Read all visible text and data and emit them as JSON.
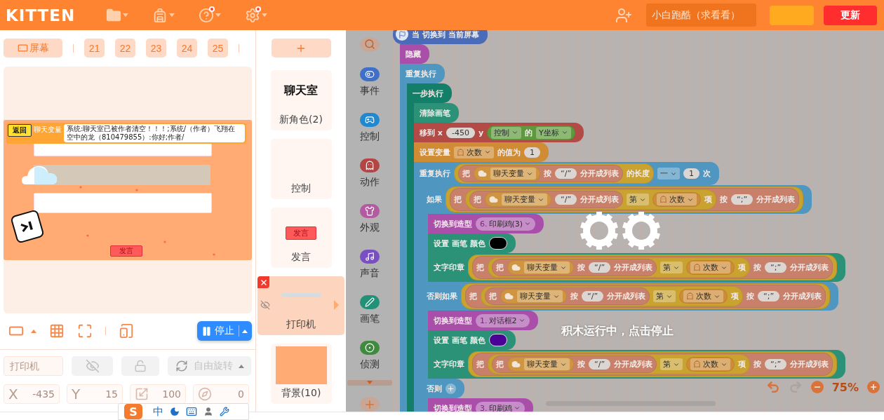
{
  "topbar": {
    "logo": "KITTEN",
    "menus": [
      {
        "kind": "folder",
        "badge": false
      },
      {
        "kind": "backpack",
        "badge": false
      },
      {
        "kind": "help",
        "badge": true
      },
      {
        "kind": "settings",
        "badge": true
      }
    ],
    "project_name": "小白跑酷（求看看）",
    "update_button": "更新"
  },
  "screen_bar": {
    "screen_button": "屏幕",
    "tabs": [
      "21",
      "22",
      "23",
      "24",
      "25"
    ]
  },
  "stage": {
    "tag": "返回",
    "monitor": {
      "name": "聊天变量",
      "value": "系统:聊天室已被作者清空！！！;系统/（作者）飞翔在空中的龙（810479855）:你好;作者/"
    },
    "send_button": "发言"
  },
  "stage_controls": {
    "stop_button": "停止"
  },
  "sprite_props": {
    "name_placeholder": "打印机",
    "rotation": "自由旋转",
    "fields": [
      {
        "kind": "label",
        "label": "X",
        "value": "-435"
      },
      {
        "kind": "label",
        "label": "Y",
        "value": "15"
      },
      {
        "kind": "size",
        "value": "100"
      },
      {
        "kind": "direction",
        "value": "0"
      }
    ]
  },
  "sprites": [
    {
      "name": "新角色(2)",
      "preview": {
        "kind": "text",
        "text": "聊天室"
      },
      "selected": false
    },
    {
      "name": "控制",
      "preview": {
        "kind": "empty"
      },
      "selected": false
    },
    {
      "name": "发言",
      "preview": {
        "kind": "button",
        "text": "发言"
      },
      "selected": false
    },
    {
      "name": "打印机",
      "preview": {
        "kind": "bar"
      },
      "selected": true
    },
    {
      "name": "背景(10)",
      "preview": {
        "kind": "fill"
      },
      "selected": false
    }
  ],
  "categories": [
    {
      "label": "事件",
      "kind": "toggle",
      "color": "#3f6fc6"
    },
    {
      "label": "控制",
      "kind": "gamepad",
      "color": "#1e88d0"
    },
    {
      "label": "动作",
      "kind": "ghost",
      "color": "#b54545"
    },
    {
      "label": "外观",
      "kind": "shirt",
      "color": "#b45aa0"
    },
    {
      "label": "声音",
      "kind": "music",
      "color": "#7a4fc2"
    },
    {
      "label": "画笔",
      "kind": "pen",
      "color": "#239178"
    },
    {
      "label": "侦测",
      "kind": "target",
      "color": "#3f8a3f"
    }
  ],
  "script": [
    {
      "kind": "hat",
      "color": "#4a6cb8",
      "parts": [
        {
          "kind": "text",
          "v": "当 切换到 当前屏幕"
        }
      ]
    },
    {
      "kind": "stack",
      "color": "#a94fa9",
      "parts": [
        {
          "kind": "text",
          "v": "隐藏"
        }
      ]
    },
    {
      "kind": "c",
      "color": "#4f97c0",
      "parts": [
        {
          "kind": "text",
          "v": "重复执行"
        }
      ],
      "children": [
        {
          "kind": "c",
          "color": "#137f68",
          "parts": [
            {
              "kind": "text",
              "v": "一步执行"
            }
          ],
          "children": [
            {
              "kind": "stack",
              "color": "#2b9177",
              "parts": [
                {
                  "kind": "text",
                  "v": "清除画笔"
                }
              ]
            },
            {
              "kind": "stack",
              "color": "#b44a46",
              "parts": [
                {
                  "kind": "text",
                  "v": "移到 x"
                },
                {
                  "kind": "num",
                  "v": "-450"
                },
                {
                  "kind": "text",
                  "v": "y"
                },
                {
                  "kind": "reporter",
                  "color": "#5c9a3c",
                  "parts": [
                    {
                      "kind": "dropdown",
                      "v": "控制"
                    },
                    {
                      "kind": "text",
                      "v": "的"
                    },
                    {
                      "kind": "dropdown",
                      "v": "Y坐标"
                    }
                  ]
                }
              ]
            },
            {
              "kind": "stack",
              "color": "#cf8c35",
              "parts": [
                {
                  "kind": "text",
                  "v": "设置变量"
                },
                {
                  "kind": "vardrop",
                  "v": "次数"
                },
                {
                  "kind": "text",
                  "v": "的值为"
                },
                {
                  "kind": "num",
                  "v": "1"
                }
              ]
            },
            {
              "kind": "c",
              "color": "#4f97c0",
              "parts": [
                {
                  "kind": "text",
                  "v": "重复执行"
                },
                {
                  "kind": "reporter",
                  "color": "#c9a230",
                  "parts": [
                    {
                      "kind": "reporter",
                      "color": "#c8806a",
                      "parts": [
                        {
                          "kind": "text",
                          "v": "把"
                        },
                        {
                          "kind": "cloud",
                          "v": "聊天变量"
                        },
                        {
                          "kind": "text",
                          "v": "按"
                        },
                        {
                          "kind": "str",
                          "v": "“/”"
                        },
                        {
                          "kind": "text",
                          "v": "分开成列表"
                        }
                      ]
                    },
                    {
                      "kind": "text",
                      "v": "的长度"
                    }
                  ]
                },
                {
                  "kind": "dropdown",
                  "v": "一"
                },
                {
                  "kind": "num",
                  "v": "1"
                },
                {
                  "kind": "text",
                  "v": "次"
                }
              ],
              "children": [
                {
                  "kind": "if",
                  "color": "#4f97c0",
                  "branches": [
                    {
                      "parts": [
                        {
                          "kind": "text",
                          "v": "如果"
                        },
                        {
                          "kind": "reporter",
                          "color": "#c9a230",
                          "parts": [
                            {
                              "kind": "reporter",
                              "color": "#c8806a",
                              "parts": [
                                {
                                  "kind": "text",
                                  "v": "把"
                                },
                                {
                                  "kind": "reporter",
                                  "color": "#c9a230",
                                  "parts": [
                                    {
                                      "kind": "reporter",
                                      "color": "#c8806a",
                                      "parts": [
                                        {
                                          "kind": "text",
                                          "v": "把"
                                        },
                                        {
                                          "kind": "cloud",
                                          "v": "聊天变量"
                                        },
                                        {
                                          "kind": "str",
                                          "v": "“/”"
                                        },
                                        {
                                          "kind": "text",
                                          "v": "分开成列表"
                                        }
                                      ]
                                    },
                                    {
                                      "kind": "dropdown",
                                      "v": "第"
                                    },
                                    {
                                      "kind": "var",
                                      "v": "次数"
                                    },
                                    {
                                      "kind": "text",
                                      "v": "项"
                                    }
                                  ]
                                },
                                {
                                  "kind": "text",
                                  "v": "按"
                                },
                                {
                                  "kind": "str",
                                  "v": "“;”"
                                },
                                {
                                  "kind": "text",
                                  "v": "分开成列表"
                                }
                              ]
                            }
                          ]
                        }
                      ],
                      "children": [
                        {
                          "kind": "stack",
                          "color": "#a94fa9",
                          "parts": [
                            {
                              "kind": "text",
                              "v": "切换到造型"
                            },
                            {
                              "kind": "costume",
                              "index": "6.",
                              "v": "印刷鸡(3)"
                            }
                          ]
                        },
                        {
                          "kind": "stack",
                          "color": "#2b9177",
                          "parts": [
                            {
                              "kind": "text",
                              "v": "设置 画笔 颜色"
                            },
                            {
                              "kind": "color",
                              "color": "#000000"
                            }
                          ]
                        },
                        {
                          "kind": "stack",
                          "color": "#2b9177",
                          "parts": [
                            {
                              "kind": "text",
                              "v": "文字印章"
                            },
                            {
                              "kind": "reporter",
                              "color": "#c9a230",
                              "parts": [
                                {
                                  "kind": "reporter",
                                  "color": "#c8806a",
                                  "parts": [
                                    {
                                      "kind": "text",
                                      "v": "把"
                                    },
                                    {
                                      "kind": "reporter",
                                      "color": "#c9a230",
                                      "parts": [
                                        {
                                          "kind": "reporter",
                                          "color": "#c8806a",
                                          "parts": [
                                            {
                                              "kind": "text",
                                              "v": "把"
                                            },
                                            {
                                              "kind": "cloud",
                                              "v": "聊天变量"
                                            },
                                            {
                                              "kind": "text",
                                              "v": "按"
                                            },
                                            {
                                              "kind": "str",
                                              "v": "“/”"
                                            },
                                            {
                                              "kind": "text",
                                              "v": "分开成列表"
                                            }
                                          ]
                                        },
                                        {
                                          "kind": "dropdown",
                                          "v": "第"
                                        },
                                        {
                                          "kind": "var",
                                          "v": "次数"
                                        },
                                        {
                                          "kind": "text",
                                          "v": "项"
                                        }
                                      ]
                                    },
                                    {
                                      "kind": "text",
                                      "v": "按"
                                    },
                                    {
                                      "kind": "str",
                                      "v": "“;”"
                                    },
                                    {
                                      "kind": "text",
                                      "v": "分开成列表"
                                    }
                                  ]
                                }
                              ]
                            }
                          ]
                        }
                      ]
                    },
                    {
                      "parts": [
                        {
                          "kind": "text",
                          "v": "否则如果"
                        },
                        {
                          "kind": "reporter",
                          "color": "#c9a230",
                          "parts": [
                            {
                              "kind": "reporter",
                              "color": "#c8806a",
                              "parts": [
                                {
                                  "kind": "text",
                                  "v": "把"
                                },
                                {
                                  "kind": "reporter",
                                  "color": "#c9a230",
                                  "parts": [
                                    {
                                      "kind": "reporter",
                                      "color": "#c8806a",
                                      "parts": [
                                        {
                                          "kind": "text",
                                          "v": "把"
                                        },
                                        {
                                          "kind": "cloud",
                                          "v": "聊天变量"
                                        },
                                        {
                                          "kind": "text",
                                          "v": "按"
                                        },
                                        {
                                          "kind": "str",
                                          "v": "“/”"
                                        },
                                        {
                                          "kind": "text",
                                          "v": "分开成列表"
                                        }
                                      ]
                                    },
                                    {
                                      "kind": "dropdown",
                                      "v": "第"
                                    },
                                    {
                                      "kind": "var",
                                      "v": "次数"
                                    },
                                    {
                                      "kind": "text",
                                      "v": "项"
                                    }
                                  ]
                                },
                                {
                                  "kind": "text",
                                  "v": "按"
                                },
                                {
                                  "kind": "str",
                                  "v": "“;”"
                                },
                                {
                                  "kind": "text",
                                  "v": "分开成列表"
                                }
                              ]
                            }
                          ]
                        }
                      ],
                      "children": [
                        {
                          "kind": "stack",
                          "color": "#a94fa9",
                          "parts": [
                            {
                              "kind": "text",
                              "v": "切换到造型"
                            },
                            {
                              "kind": "costume",
                              "index": "1.",
                              "v": "对话框2"
                            }
                          ]
                        },
                        {
                          "kind": "stack",
                          "color": "#2b9177",
                          "parts": [
                            {
                              "kind": "text",
                              "v": "设置 画笔 颜色"
                            },
                            {
                              "kind": "color",
                              "color": "#4b0096"
                            }
                          ]
                        },
                        {
                          "kind": "stack",
                          "color": "#2b9177",
                          "parts": [
                            {
                              "kind": "text",
                              "v": "文字印章"
                            },
                            {
                              "kind": "reporter",
                              "color": "#c9a230",
                              "parts": [
                                {
                                  "kind": "reporter",
                                  "color": "#c8806a",
                                  "parts": [
                                    {
                                      "kind": "text",
                                      "v": "把"
                                    },
                                    {
                                      "kind": "reporter",
                                      "color": "#c9a230",
                                      "parts": [
                                        {
                                          "kind": "reporter",
                                          "color": "#c8806a",
                                          "parts": [
                                            {
                                              "kind": "text",
                                              "v": "把"
                                            },
                                            {
                                              "kind": "cloud",
                                              "v": "聊天变量"
                                            },
                                            {
                                              "kind": "text",
                                              "v": "按"
                                            },
                                            {
                                              "kind": "str",
                                              "v": "“/”"
                                            },
                                            {
                                              "kind": "text",
                                              "v": "分开成列表"
                                            }
                                          ]
                                        },
                                        {
                                          "kind": "dropdown",
                                          "v": "第"
                                        },
                                        {
                                          "kind": "var",
                                          "v": "次数"
                                        },
                                        {
                                          "kind": "text",
                                          "v": "项"
                                        }
                                      ]
                                    },
                                    {
                                      "kind": "text",
                                      "v": "按"
                                    },
                                    {
                                      "kind": "str",
                                      "v": "“;”"
                                    },
                                    {
                                      "kind": "text",
                                      "v": "分开成列表"
                                    }
                                  ]
                                }
                              ]
                            }
                          ]
                        }
                      ]
                    },
                    {
                      "parts": [
                        {
                          "kind": "text",
                          "v": "否则"
                        },
                        {
                          "kind": "add"
                        }
                      ],
                      "children": [
                        {
                          "kind": "stack",
                          "color": "#a94fa9",
                          "parts": [
                            {
                              "kind": "text",
                              "v": "切换到造型"
                            },
                            {
                              "kind": "costume",
                              "index": "3.",
                              "v": "印刷鸡"
                            }
                          ]
                        }
                      ]
                    }
                  ]
                }
              ]
            }
          ]
        }
      ]
    }
  ],
  "run_overlay": {
    "message": "积木运行中，点击停止"
  },
  "zoom": {
    "level_text": "75%"
  },
  "ime": {
    "logo": "S",
    "mode": "中"
  }
}
